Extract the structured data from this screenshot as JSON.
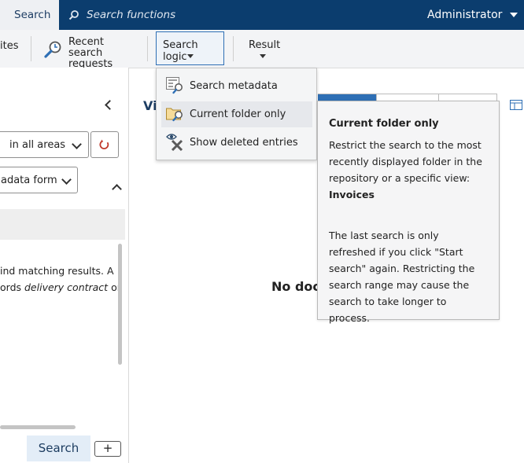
{
  "topbar": {
    "tab_search": "Search",
    "search_functions": "Search functions",
    "user": "Administrator"
  },
  "ribbon": {
    "favorites_partial": "ites",
    "recent_line1": "Recent search",
    "recent_line2": "requests",
    "search_logic": "Search logic",
    "result": "Result"
  },
  "left_panel": {
    "scope_select": "in all areas",
    "form_select": "adata form",
    "info_line1": "ind matching results. A",
    "info_line2_pre": "ords ",
    "info_line2_em": "delivery contract",
    "info_line2_post": " or",
    "search_button": "Search",
    "add_button": "+"
  },
  "main": {
    "view_partial": "Vi",
    "no_docs_partial": "No doc"
  },
  "search_logic_menu": {
    "items": [
      {
        "label": "Search metadata",
        "icon": "search-metadata-icon"
      },
      {
        "label": "Current folder only",
        "icon": "folder-search-icon"
      },
      {
        "label": "Show deleted entries",
        "icon": "show-deleted-icon"
      }
    ]
  },
  "tooltip": {
    "title": "Current folder only",
    "para1": "Restrict the search to the most recently displayed folder in the repository or a specific view:",
    "para1_bold": "Invoices",
    "para2": "The last search is only refreshed if you click \"Start search\" again. Restricting the search range may cause the search to take longer to process."
  },
  "colors": {
    "topbar": "#0b3d6e",
    "accent": "#2e6fb5",
    "reset_icon": "#c0392b"
  }
}
